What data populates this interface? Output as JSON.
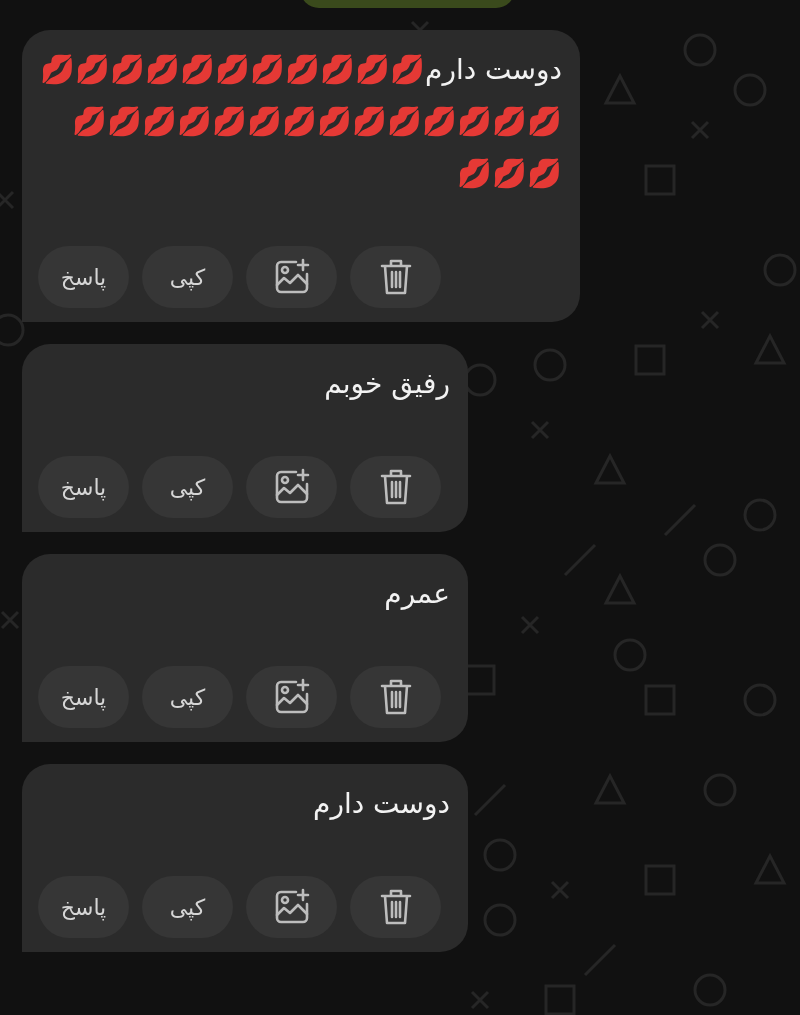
{
  "messages": [
    {
      "text": "دوست دارم💋💋💋💋💋💋💋💋💋💋💋💋💋💋💋💋💋💋💋💋💋💋💋💋💋💋💋💋",
      "actions": [
        {
          "kind": "delete"
        },
        {
          "kind": "image"
        },
        {
          "kind": "copy",
          "label": "کپی"
        },
        {
          "kind": "reply",
          "label": "پاسخ"
        }
      ]
    },
    {
      "text": "رفیق خوبم",
      "actions": [
        {
          "kind": "delete"
        },
        {
          "kind": "image"
        },
        {
          "kind": "copy",
          "label": "کپی"
        },
        {
          "kind": "reply",
          "label": "پاسخ"
        }
      ]
    },
    {
      "text": "عمرم",
      "actions": [
        {
          "kind": "delete"
        },
        {
          "kind": "image"
        },
        {
          "kind": "copy",
          "label": "کپی"
        },
        {
          "kind": "reply",
          "label": "پاسخ"
        }
      ]
    },
    {
      "text": "دوست دارم",
      "actions": [
        {
          "kind": "delete"
        },
        {
          "kind": "image"
        },
        {
          "kind": "copy",
          "label": "کپی"
        },
        {
          "kind": "reply",
          "label": "پاسخ"
        }
      ]
    }
  ]
}
